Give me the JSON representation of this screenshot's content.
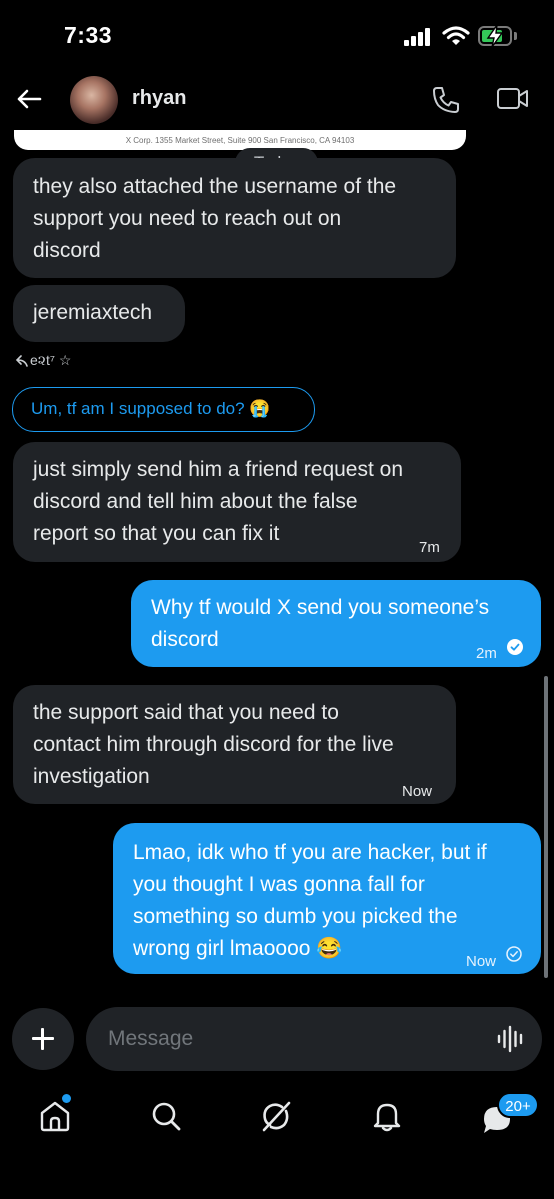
{
  "status_bar": {
    "time": "7:33"
  },
  "header": {
    "name": "rhyan"
  },
  "card": {
    "address": "X Corp. 1355 Market Street, Suite 900 San Francisco, CA 94103"
  },
  "day_divider": "Today",
  "messages": [
    {
      "dir": "in",
      "lines": [
        "they also attached the username of the",
        "support you need to reach out on",
        "discord"
      ],
      "time": ""
    },
    {
      "dir": "in",
      "lines": [
        "jeremiaxtech"
      ],
      "time": ""
    },
    {
      "dir": "in",
      "lines": [
        "just simply send him a friend request on",
        "discord and tell him about the false",
        "report so that you can fix it"
      ],
      "time": "7m"
    },
    {
      "dir": "out",
      "lines": [
        "Why tf would X send you someone’s",
        "discord"
      ],
      "time": "2m"
    },
    {
      "dir": "in",
      "lines": [
        "the support said that you need to",
        "contact him through discord for the live",
        "investigation"
      ],
      "time": "Now"
    },
    {
      "dir": "out",
      "lines": [
        "Lmao, idk who tf you are hacker, but if",
        "you thought I was gonna fall for",
        "something so dumb you picked the",
        "wrong girl lmaoooo 😂"
      ],
      "time": "Now"
    }
  ],
  "reply_tag": "e૨t⁷ ☆",
  "quoted_reply": "Um, tf am I supposed to do? 😭",
  "composer": {
    "placeholder": "Message"
  },
  "nav": {
    "messages_badge": "20+"
  },
  "colors": {
    "accent": "#1d9bf0",
    "bubble_in": "#202327",
    "background": "#000000"
  },
  "icons": [
    "back-arrow-icon",
    "phone-icon",
    "video-icon",
    "plus-icon",
    "voice-icon",
    "home-icon",
    "search-icon",
    "grok-icon",
    "bell-icon",
    "messages-icon",
    "read-check-icon",
    "sent-check-icon"
  ]
}
